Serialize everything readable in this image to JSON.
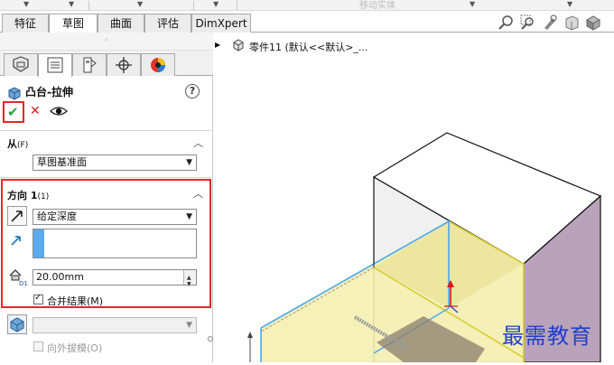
{
  "tabs": [
    "特征",
    "草图",
    "曲面",
    "评估",
    "DimXpert"
  ],
  "active_tab": "草图",
  "toolbar_ghost_label": "移动实体",
  "panel": {
    "feature_title": "凸台-拉伸",
    "help_label": "?",
    "from_section": {
      "label": "从",
      "shortcut": "(F)",
      "value": "草图基准面"
    },
    "direction_section": {
      "label": "方向 1",
      "shortcut": "(1)",
      "end_condition": "给定深度",
      "depth_value": "20.00mm",
      "merge_label": "合并结果(M)",
      "merge_checked": true
    },
    "draft_label": "向外拔模(O)",
    "draft_checked": false
  },
  "tree": {
    "text": "零件11  (默认<<默认>_..."
  },
  "watermark": "最需教育",
  "colors": {
    "highlight_red": "#e02a2a",
    "confirm_green": "#2aa335",
    "cancel_red": "#d21f1f",
    "selection_blue": "#5aaaf0",
    "edge_blue": "#4aa8f0",
    "sketch_yellow": "#e8e060",
    "face_purple": "#b9a3bb",
    "watermark_blue": "#2040c8"
  },
  "icons": [
    "shield-icon",
    "feature-tree-icon",
    "property-icon",
    "config-icon",
    "display-icon",
    "extrude-icon",
    "help-icon",
    "check-icon",
    "close-icon",
    "eye-icon",
    "reverse-direction-icon",
    "direction-arrow-icon",
    "depth-icon",
    "thin-feature-icon",
    "part-icon",
    "zoom-fit-icon",
    "zoom-area-icon",
    "previous-view-icon",
    "section-view-icon",
    "view-orientation-icon"
  ]
}
